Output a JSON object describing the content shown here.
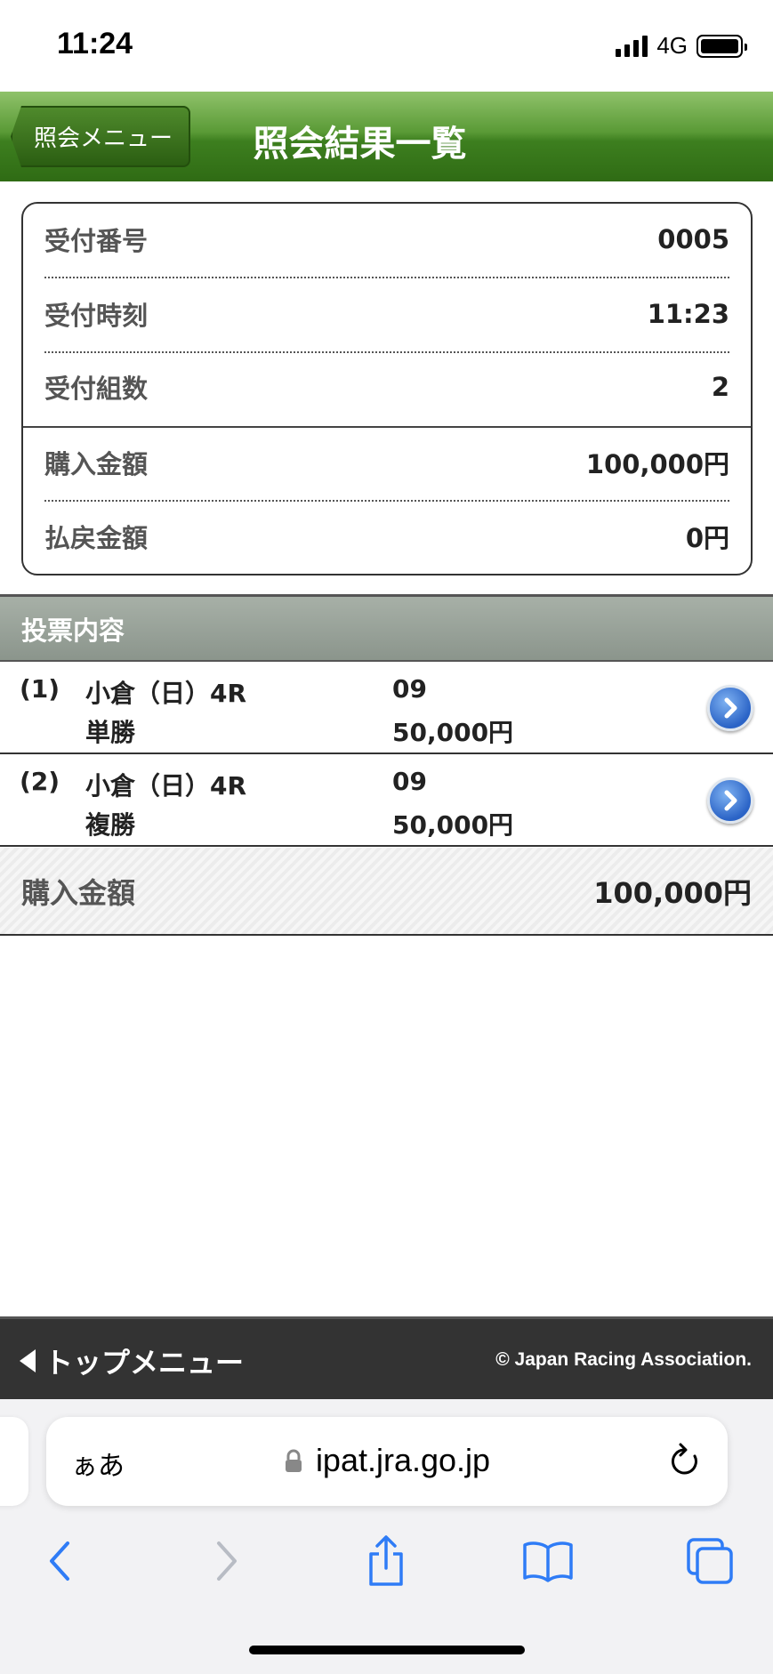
{
  "status_bar": {
    "time": "11:24",
    "network": "4G"
  },
  "header": {
    "back_label": "照会メニュー",
    "title": "照会結果一覧"
  },
  "info": {
    "rows": [
      {
        "label": "受付番号",
        "value": "0005"
      },
      {
        "label": "受付時刻",
        "value": "11:23"
      },
      {
        "label": "受付組数",
        "value": "2"
      },
      {
        "label": "購入金額",
        "value": "100,000円"
      },
      {
        "label": "払戻金額",
        "value": "0円"
      }
    ]
  },
  "votes": {
    "section_title": "投票内容",
    "items": [
      {
        "num": "(1)",
        "race": "小倉（日）4R",
        "type": "単勝",
        "horse": "09",
        "amount": "50,000円"
      },
      {
        "num": "(2)",
        "race": "小倉（日）4R",
        "type": "複勝",
        "horse": "09",
        "amount": "50,000円"
      }
    ],
    "total_label": "購入金額",
    "total_value": "100,000円"
  },
  "footer": {
    "top_menu": "トップメニュー",
    "copyright": "© Japan Racing Association."
  },
  "safari": {
    "aa": "ぁあ",
    "url": "ipat.jra.go.jp"
  },
  "icons": {
    "back": "chevron-left-icon",
    "forward": "chevron-right-icon",
    "share": "share-icon",
    "bookmarks": "book-icon",
    "tabs": "tabs-icon",
    "lock": "lock-icon",
    "reload": "reload-icon"
  }
}
